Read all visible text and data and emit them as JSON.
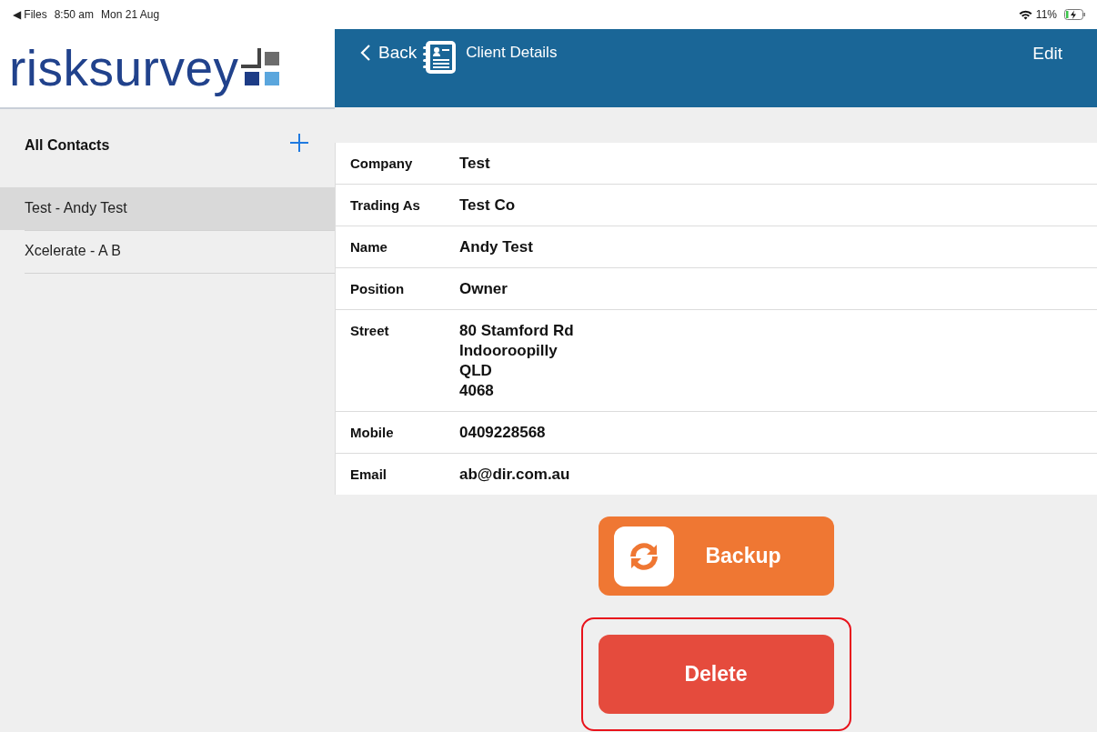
{
  "status_bar": {
    "back_app": "◀ Files",
    "time": "8:50 am",
    "date": "Mon 21 Aug",
    "battery": "11%"
  },
  "logo": {
    "text": "risksurvey"
  },
  "nav_bar": {
    "back": "Back",
    "title": "Client Details",
    "action": "Edit"
  },
  "sidebar": {
    "title": "All Contacts",
    "items": [
      {
        "label": "Test - Andy Test",
        "selected": true
      },
      {
        "label": "Xcelerate - A B",
        "selected": false
      }
    ]
  },
  "details": [
    {
      "label": "Company",
      "value": "Test"
    },
    {
      "label": "Trading As",
      "value": "Test Co"
    },
    {
      "label": "Name",
      "value": "Andy Test"
    },
    {
      "label": "Position",
      "value": "Owner"
    },
    {
      "label": "Street",
      "value": "80 Stamford Rd\nIndooroopilly\nQLD\n4068"
    },
    {
      "label": "Mobile",
      "value": "0409228568"
    },
    {
      "label": "Email",
      "value": "ab@dir.com.au"
    }
  ],
  "buttons": [
    {
      "label": "Backup",
      "kind": "backup",
      "highlighted": false
    },
    {
      "label": "Delete",
      "kind": "delete",
      "highlighted": true
    }
  ]
}
